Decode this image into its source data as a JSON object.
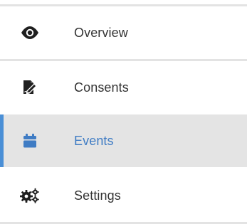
{
  "sidebar": {
    "accent_color": "#4a8fd6",
    "items": [
      {
        "label": "Overview",
        "icon": "eye-icon",
        "active": false
      },
      {
        "label": "Consents",
        "icon": "signature-document-icon",
        "active": false
      },
      {
        "label": "Events",
        "icon": "calendar-icon",
        "active": true
      },
      {
        "label": "Settings",
        "icon": "gears-icon",
        "active": false
      }
    ]
  }
}
